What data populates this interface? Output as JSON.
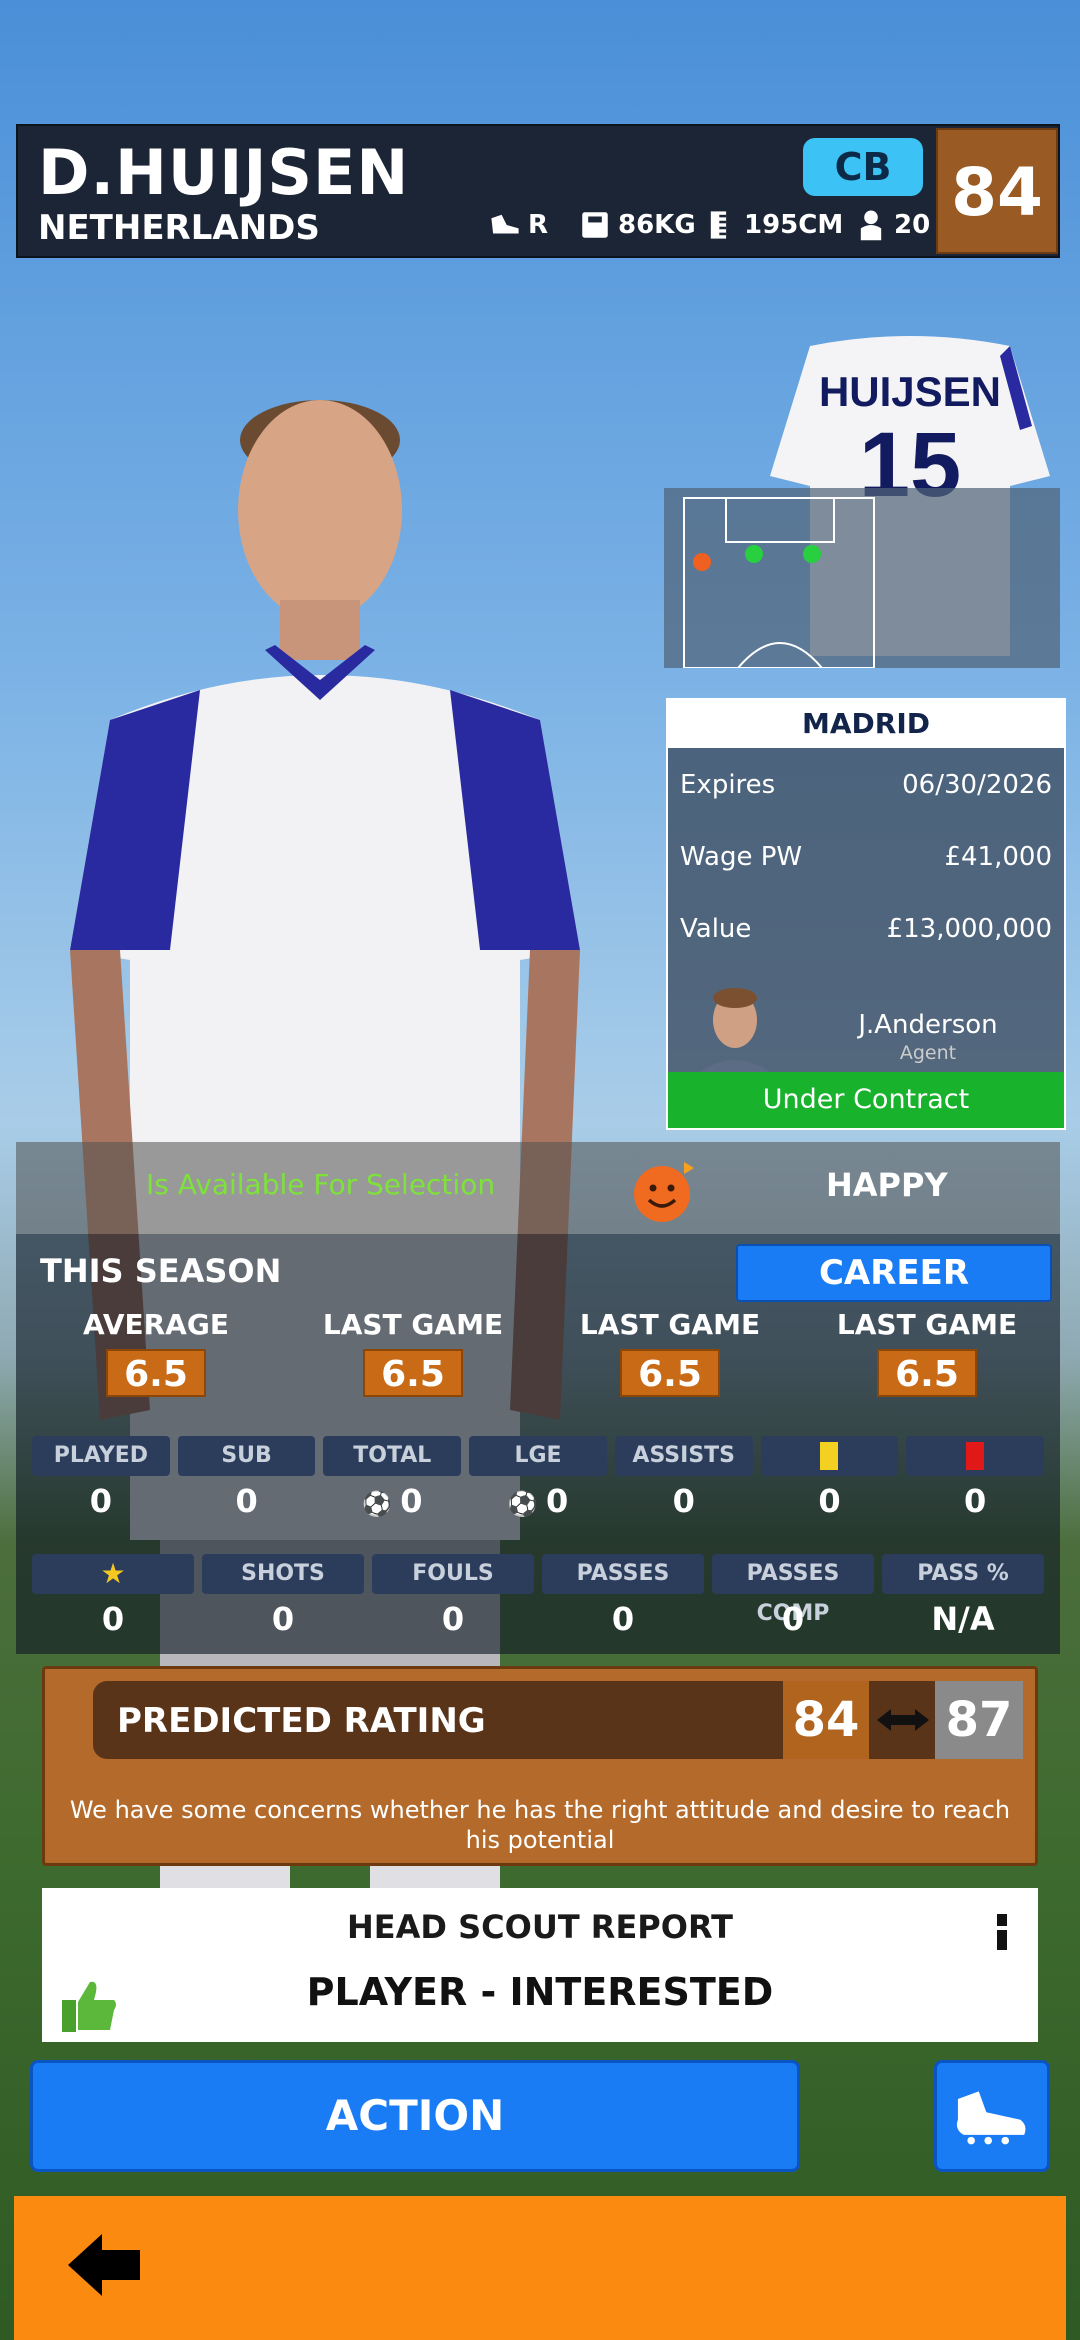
{
  "header": {
    "name": "D.HUIJSEN",
    "nation": "NETHERLANDS",
    "position": "CB",
    "overall": "84",
    "foot": "R",
    "weight": "86KG",
    "height": "195CM",
    "age": "20"
  },
  "shirt": {
    "name": "HUIJSEN",
    "number": "15"
  },
  "contract": {
    "club": "MADRID",
    "rows": [
      {
        "label": "Expires",
        "value": "06/30/2026"
      },
      {
        "label": "Wage PW",
        "value": "£41,000"
      },
      {
        "label": "Value",
        "value": "£13,000,000"
      }
    ],
    "agent_name": "J.Anderson",
    "agent_label": "Agent",
    "status": "Under Contract"
  },
  "availability": {
    "text": "Is Available For Selection",
    "mood": "HAPPY"
  },
  "season": {
    "title": "THIS SEASON",
    "career_button": "CAREER",
    "ratings": [
      {
        "label": "AVERAGE",
        "value": "6.5"
      },
      {
        "label": "LAST GAME",
        "value": "6.5"
      },
      {
        "label": "LAST GAME",
        "value": "6.5"
      },
      {
        "label": "LAST GAME",
        "value": "6.5"
      }
    ],
    "row1": [
      {
        "label": "PLAYED",
        "value": "0"
      },
      {
        "label": "SUB",
        "value": "0"
      },
      {
        "label": "TOTAL",
        "value": "0"
      },
      {
        "label": "LGE",
        "value": "0"
      },
      {
        "label": "ASSISTS",
        "value": "0"
      },
      {
        "label": "",
        "value": "0"
      },
      {
        "label": "",
        "value": "0"
      }
    ],
    "row2": [
      {
        "label": "",
        "value": "0"
      },
      {
        "label": "SHOTS",
        "value": "0"
      },
      {
        "label": "FOULS",
        "value": "0"
      },
      {
        "label": "PASSES",
        "value": "0"
      },
      {
        "label": "PASSES COMP",
        "value": "0"
      },
      {
        "label": "PASS %",
        "value": "N/A"
      }
    ]
  },
  "predicted": {
    "label": "PREDICTED RATING",
    "low": "84",
    "high": "87",
    "text": "We have some concerns whether he has the right attitude and desire to reach his potential"
  },
  "scout": {
    "title": "HEAD SCOUT REPORT",
    "verdict": "PLAYER - INTERESTED"
  },
  "actions": {
    "action_label": "ACTION"
  },
  "colors": {
    "accent_blue": "#1a7cf4",
    "orange": "#fb8a10",
    "rating_orange": "#c86a16",
    "green": "#19b22c"
  }
}
